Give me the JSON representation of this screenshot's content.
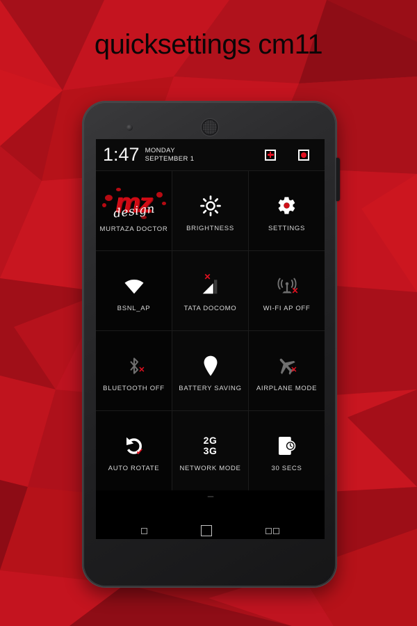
{
  "page": {
    "title": "quicksettings cm11",
    "background_theme": "red-low-poly",
    "accent_color": "#e11020",
    "background_colors": [
      "#c4141f",
      "#8e0d16",
      "#e01f2a",
      "#a51019",
      "#6e0a11",
      "#d41a25"
    ]
  },
  "device": {
    "name": "nexus-5-black",
    "front_camera": "camera-icon",
    "earpiece": "speaker-grille-icon",
    "power_button": "power-button"
  },
  "statusbar": {
    "time": "1:47",
    "day": "MONDAY",
    "date": "SEPTEMBER 1",
    "icons": [
      {
        "name": "add-tile-icon",
        "glyph": "plus",
        "color": "#e11020"
      },
      {
        "name": "record-indicator-icon",
        "glyph": "dot",
        "color": "#e11020"
      }
    ]
  },
  "tiles": [
    {
      "id": "profile",
      "label": "MURTAZA DOCTOR",
      "icon": "mz-design-logo",
      "state": "on",
      "logo_primary": "mz",
      "logo_script": "design"
    },
    {
      "id": "brightness",
      "label": "BRIGHTNESS",
      "icon": "brightness-sun-icon",
      "state": "on"
    },
    {
      "id": "settings",
      "label": "SETTINGS",
      "icon": "settings-gear-icon",
      "state": "on"
    },
    {
      "id": "wifi",
      "label": "BSNL_AP",
      "icon": "wifi-icon",
      "state": "on"
    },
    {
      "id": "mobile-data",
      "label": "TATA DOCOMO",
      "icon": "signal-bars-icon",
      "state": "off"
    },
    {
      "id": "wifi-hotspot",
      "label": "WI-FI AP OFF",
      "icon": "hotspot-tower-icon",
      "state": "off"
    },
    {
      "id": "bluetooth",
      "label": "BLUETOOTH OFF",
      "icon": "bluetooth-icon",
      "state": "off"
    },
    {
      "id": "battery-saving",
      "label": "BATTERY SAVING",
      "icon": "location-pin-icon",
      "state": "on"
    },
    {
      "id": "airplane-mode",
      "label": "AIRPLANE MODE",
      "icon": "airplane-icon",
      "state": "off"
    },
    {
      "id": "auto-rotate",
      "label": "AUTO ROTATE",
      "icon": "rotate-icon",
      "state": "on"
    },
    {
      "id": "network-mode",
      "label": "NETWORK MODE",
      "icon": "network-2g3g-text",
      "state": "on",
      "icon_text_top": "2G",
      "icon_text_bottom": "3G"
    },
    {
      "id": "screen-timeout",
      "label": "30 SECS",
      "icon": "screen-timeout-icon",
      "state": "on"
    }
  ],
  "navbar": {
    "items": [
      {
        "name": "nav-back-button",
        "icon": "back-square-icon"
      },
      {
        "name": "nav-home-button",
        "icon": "home-square-icon"
      },
      {
        "name": "nav-recents-button",
        "icon": "recents-double-square-icon"
      }
    ]
  }
}
